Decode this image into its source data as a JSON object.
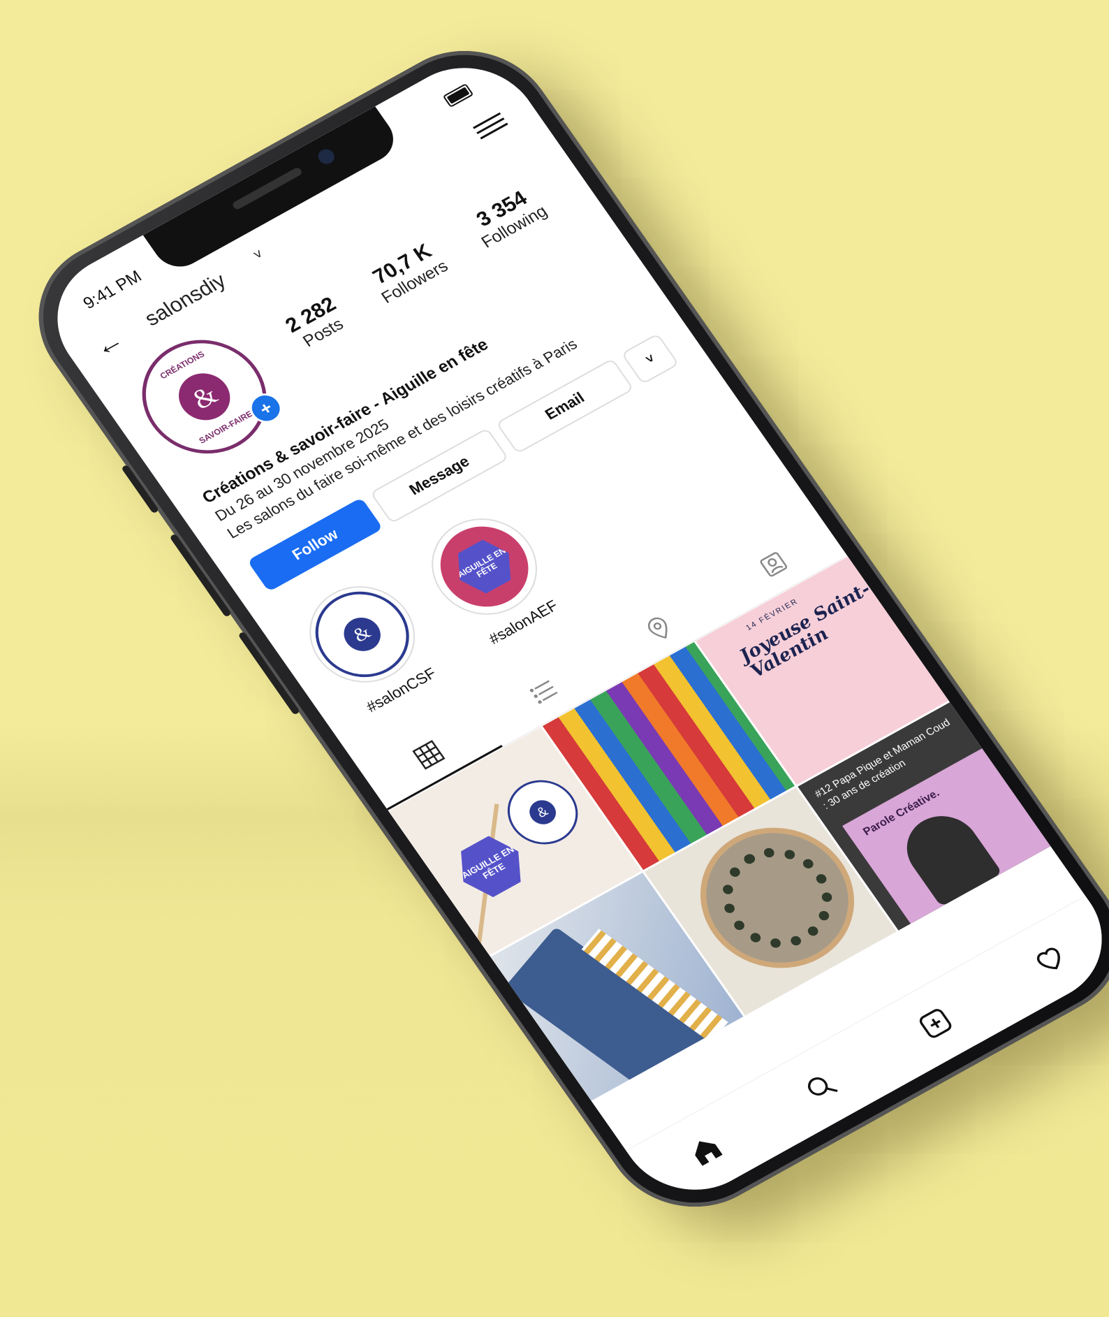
{
  "status": {
    "time": "9:41 PM"
  },
  "header": {
    "username": "salonsdiy"
  },
  "profile": {
    "avatar_ring_top": "CRÉATIONS",
    "avatar_ring_bottom": "SAVOIR-FAIRE",
    "avatar_symbol": "&",
    "stats": [
      {
        "value": "2 282",
        "label": "Posts"
      },
      {
        "value": "70,7 K",
        "label": "Followers"
      },
      {
        "value": "3 354",
        "label": "Following"
      }
    ]
  },
  "bio": {
    "name": "Créations & savoir-faire - Aiguille en fête",
    "line1": "Du 26 au 30 novembre 2025",
    "line2": "Les salons du faire soi-même et des loisirs créatifs à Paris"
  },
  "actions": {
    "follow": "Follow",
    "message": "Message",
    "email": "Email",
    "more": "˅"
  },
  "highlights": [
    {
      "label": "#salonCSF",
      "symbol": "&"
    },
    {
      "label": "#salonAEF",
      "badge": "AIGUILLE EN FÊTE"
    }
  ],
  "grid": {
    "post1_badge": "AIGUILLE EN FÊTE",
    "post1_symbol": "&",
    "post3_small": "14 FÉVRIER",
    "post3_title": "Joyeuse Saint-Valentin",
    "post6_caption": "#12 Papa Pique et Maman Coud : 30 ans de création",
    "post6_brand": "Parole Créative."
  },
  "colors": {
    "background": "#f3eb9a",
    "follow_button": "#1a6df2",
    "brand_purple": "#8b2a70",
    "brand_blue": "#2b3a8f"
  },
  "icons": {
    "back": "arrow-left-icon",
    "menu": "hamburger-icon",
    "tab_grid": "grid-icon",
    "tab_list": "list-icon",
    "tab_location": "location-pin-icon",
    "tab_tagged": "tagged-person-icon",
    "nav_home": "home-icon",
    "nav_search": "search-icon",
    "nav_add": "add-post-icon",
    "nav_activity": "heart-icon"
  }
}
